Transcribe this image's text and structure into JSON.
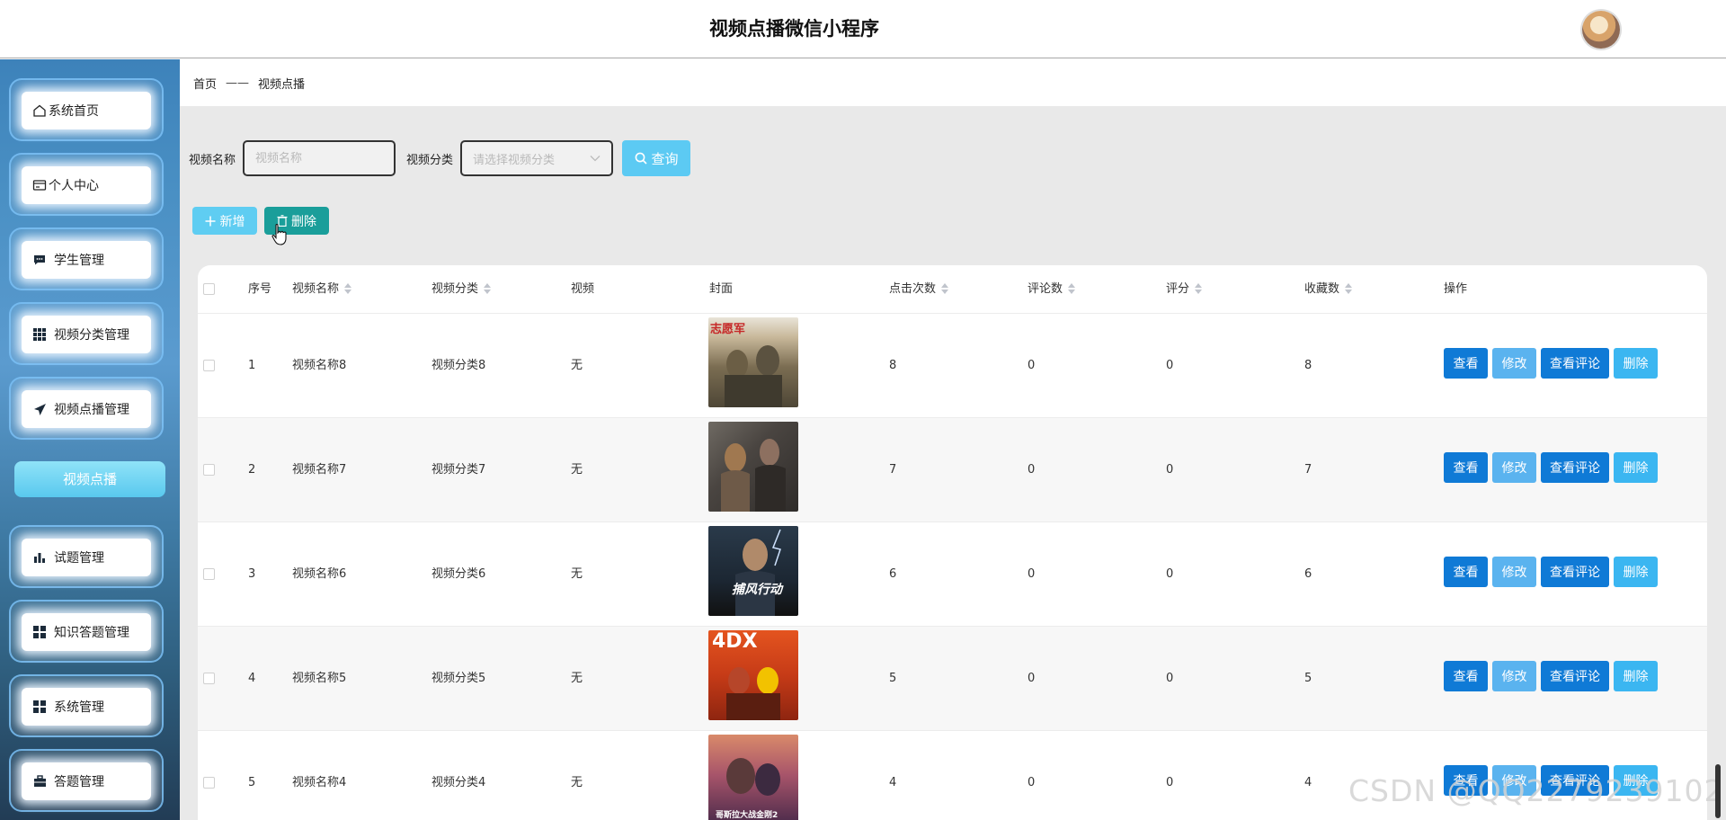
{
  "header": {
    "title": "视频点播微信小程序",
    "avatar_icon": "user-avatar-icon"
  },
  "sidebar": {
    "items": [
      {
        "label": "系统首页",
        "icon": "home-icon"
      },
      {
        "label": "个人中心",
        "icon": "id-card-icon"
      },
      {
        "label": "学生管理",
        "icon": "chat-icon"
      },
      {
        "label": "视频分类管理",
        "icon": "grid-icon"
      },
      {
        "label": "视频点播管理",
        "icon": "paper-plane-icon"
      },
      {
        "label": "试题管理",
        "icon": "bar-chart-icon"
      },
      {
        "label": "知识答题管理",
        "icon": "apps-icon"
      },
      {
        "label": "系统管理",
        "icon": "apps-icon"
      },
      {
        "label": "答题管理",
        "icon": "briefcase-icon"
      }
    ],
    "active_submenu": "视频点播"
  },
  "breadcrumb": {
    "home": "首页",
    "separator": "——",
    "current": "视频点播"
  },
  "search": {
    "name_label": "视频名称",
    "name_placeholder": "视频名称",
    "category_label": "视频分类",
    "category_placeholder": "请选择视频分类",
    "query_button": "查询"
  },
  "actions": {
    "add_button": "新增",
    "delete_button": "删除"
  },
  "table": {
    "headers": {
      "index": "序号",
      "name": "视频名称",
      "category": "视频分类",
      "video": "视频",
      "cover": "封面",
      "clicks": "点击次数",
      "comments": "评论数",
      "score": "评分",
      "favorites": "收藏数",
      "operations": "操作"
    },
    "row_buttons": {
      "view": "查看",
      "edit": "修改",
      "view_comments": "查看评论",
      "delete": "删除"
    },
    "rows": [
      {
        "index": "1",
        "name": "视频名称8",
        "category": "视频分类8",
        "video": "无",
        "cover_text": "志愿军",
        "clicks": "8",
        "comments": "0",
        "score": "0",
        "favorites": "8"
      },
      {
        "index": "2",
        "name": "视频名称7",
        "category": "视频分类7",
        "video": "无",
        "cover_text": "",
        "clicks": "7",
        "comments": "0",
        "score": "0",
        "favorites": "7"
      },
      {
        "index": "3",
        "name": "视频名称6",
        "category": "视频分类6",
        "video": "无",
        "cover_text": "捕风行动",
        "clicks": "6",
        "comments": "0",
        "score": "0",
        "favorites": "6"
      },
      {
        "index": "4",
        "name": "视频名称5",
        "category": "视频分类5",
        "video": "无",
        "cover_text": "4DX",
        "clicks": "5",
        "comments": "0",
        "score": "0",
        "favorites": "5"
      },
      {
        "index": "5",
        "name": "视频名称4",
        "category": "视频分类4",
        "video": "无",
        "cover_text": "哥斯拉大战金刚2",
        "clicks": "4",
        "comments": "0",
        "score": "0",
        "favorites": "4"
      }
    ]
  },
  "watermark": "CSDN @QQ2279239102",
  "colors": {
    "primary": "#0f7ad6",
    "light": "#5ab3ef",
    "teal": "#1a9e9a",
    "query": "#5ccaf3"
  }
}
